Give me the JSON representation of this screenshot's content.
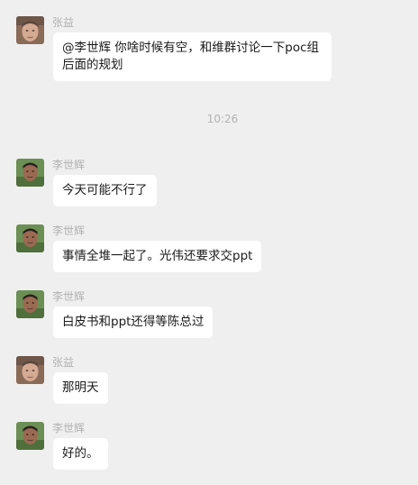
{
  "time_divider": "10:26",
  "messages": [
    {
      "sender": "张益",
      "text": "@李世辉 你啥时候有空，和维群讨论一下poc组后面的规划",
      "avatar": "avatar-zhangyi"
    },
    {
      "sender": "李世辉",
      "text": "今天可能不行了",
      "avatar": "avatar-lishihui"
    },
    {
      "sender": "李世辉",
      "text": "事情全堆一起了。光伟还要求交ppt",
      "avatar": "avatar-lishihui"
    },
    {
      "sender": "李世辉",
      "text": "白皮书和ppt还得等陈总过",
      "avatar": "avatar-lishihui"
    },
    {
      "sender": "张益",
      "text": "那明天",
      "avatar": "avatar-zhangyi"
    },
    {
      "sender": "李世辉",
      "text": "好的。",
      "avatar": "avatar-lishihui"
    }
  ]
}
